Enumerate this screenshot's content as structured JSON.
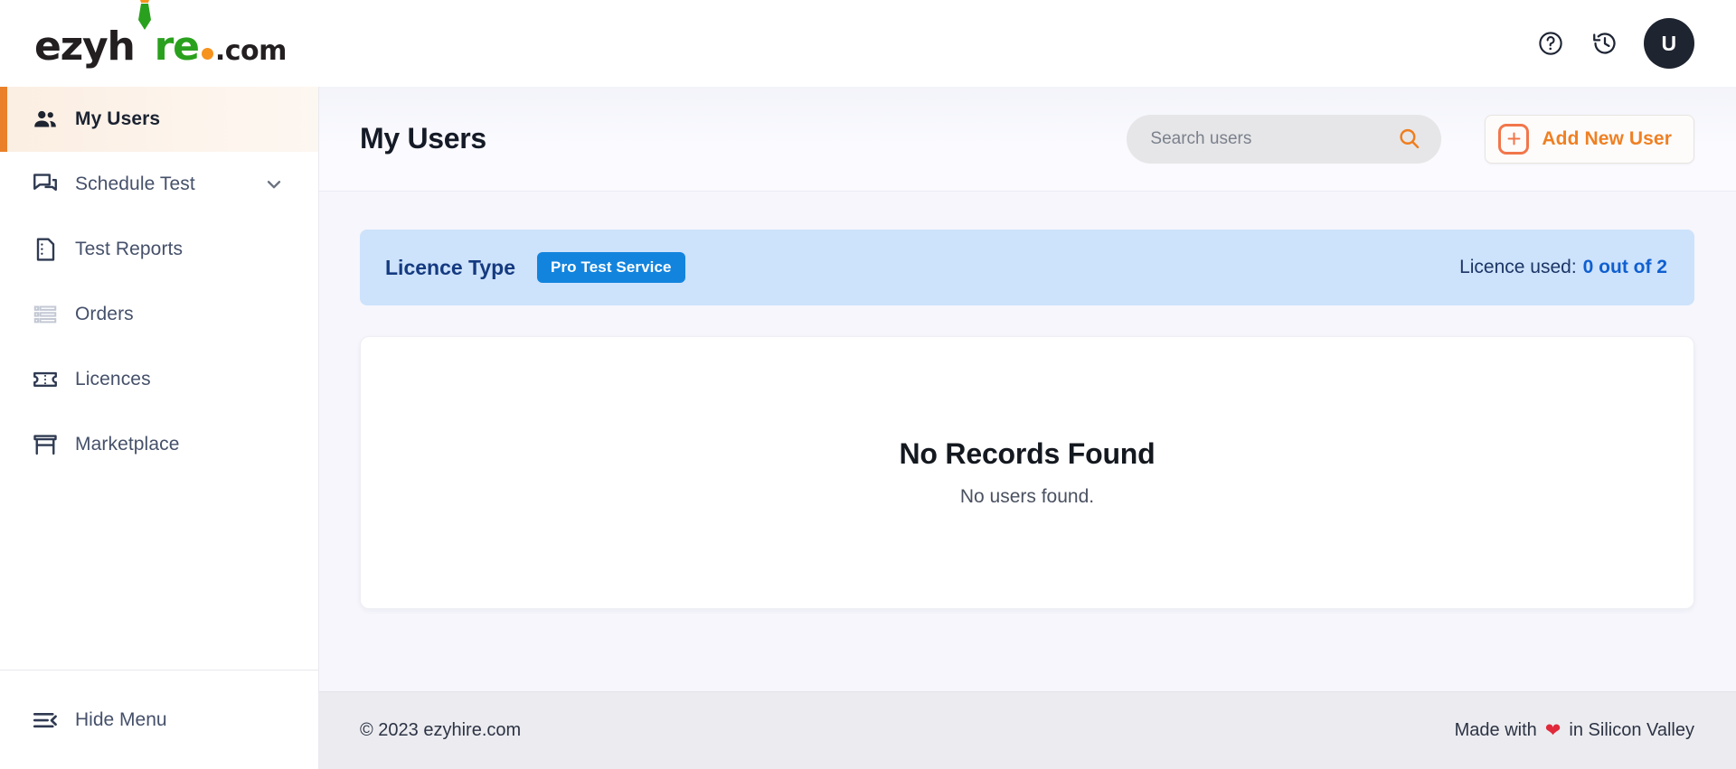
{
  "brand": {
    "name_part1": "ezyh",
    "name_part2": "re",
    "suffix": ".com",
    "accent_orange": "#f6921e",
    "accent_green": "#2aa11e",
    "dark": "#231f20"
  },
  "topbar": {
    "help_icon": "help-circle-icon",
    "history_icon": "history-clock-icon",
    "avatar_initial": "U"
  },
  "sidebar": {
    "items": [
      {
        "label": "My Users",
        "icon": "people-icon",
        "active": true,
        "has_chevron": false
      },
      {
        "label": "Schedule Test",
        "icon": "chat-bubbles-icon",
        "active": false,
        "has_chevron": true
      },
      {
        "label": "Test Reports",
        "icon": "document-icon",
        "active": false,
        "has_chevron": false
      },
      {
        "label": "Orders",
        "icon": "list-icon",
        "active": false,
        "has_chevron": false
      },
      {
        "label": "Licences",
        "icon": "ticket-icon",
        "active": false,
        "has_chevron": false
      },
      {
        "label": "Marketplace",
        "icon": "store-icon",
        "active": false,
        "has_chevron": false
      }
    ],
    "hide_menu_label": "Hide Menu",
    "hide_menu_icon": "menu-collapse-icon",
    "active_accent": "#ea8029"
  },
  "page": {
    "title": "My Users"
  },
  "search": {
    "placeholder": "Search users",
    "value": "",
    "icon": "search-icon"
  },
  "add_button": {
    "label": "Add New User",
    "icon": "plus-icon",
    "accent": "#ef8024"
  },
  "licence_banner": {
    "title": "Licence Type",
    "badge": "Pro Test Service",
    "used_label": "Licence used:",
    "used_value": "0 out of 2",
    "background": "#cde2fb",
    "badge_color": "#1384dd"
  },
  "records": {
    "title": "No Records Found",
    "subtitle": "No users found."
  },
  "footer": {
    "copyright": "© 2023 ezyhire.com",
    "made_with_prefix": "Made with",
    "heart": "❤",
    "made_with_suffix": "in Silicon Valley"
  }
}
